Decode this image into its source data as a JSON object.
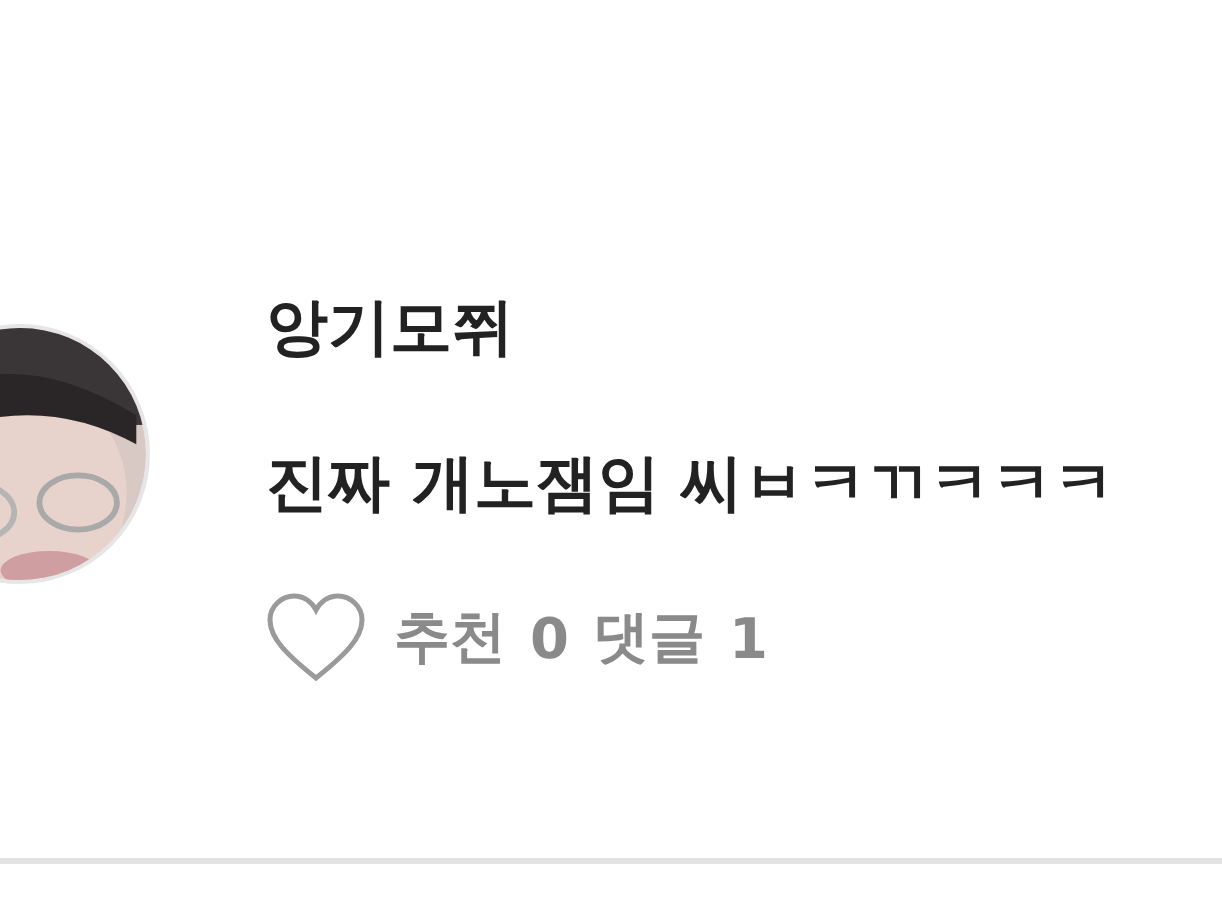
{
  "comment": {
    "author": "앙기모쮜",
    "text": "진짜 개노잼임 씨ㅂㅋㄲㅋㅋㅋ",
    "liked": false,
    "likes_label": "추천",
    "likes": "0",
    "replies_label": "댓글",
    "replies": "1"
  }
}
